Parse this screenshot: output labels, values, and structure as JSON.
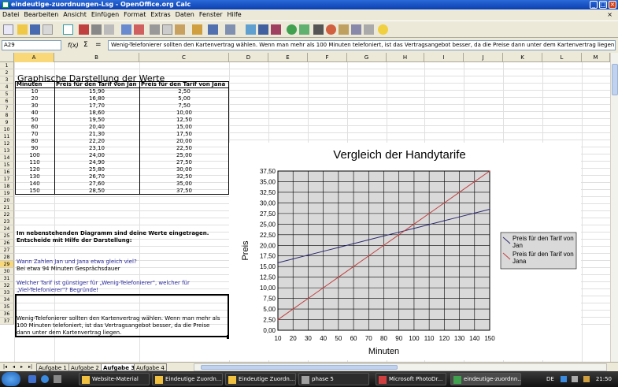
{
  "window": {
    "title": "eindeutige-zuordnungen-Lsg - OpenOffice.org Calc"
  },
  "menu": [
    "Datei",
    "Bearbeiten",
    "Ansicht",
    "Einfügen",
    "Format",
    "Extras",
    "Daten",
    "Fenster",
    "Hilfe"
  ],
  "formula": {
    "namebox": "A29",
    "fx": "f(x)",
    "sigma": "Σ",
    "eq": "=",
    "content": "Wenig-Telefonierer sollten den Kartenvertrag wählen. Wenn man mehr als 100 Minuten telefoniert, ist das Vertragsangebot besser, da die Preise dann unter dem Kartenvertrag liegen."
  },
  "columns": [
    "A",
    "B",
    "C",
    "D",
    "E",
    "F",
    "G",
    "H",
    "I",
    "J",
    "K",
    "L",
    "M"
  ],
  "rows": [
    "1",
    "2",
    "3",
    "4",
    "5",
    "6",
    "7",
    "8",
    "9",
    "10",
    "11",
    "12",
    "13",
    "14",
    "15",
    "16",
    "17",
    "18",
    "19",
    "20",
    "21",
    "22",
    "23",
    "24",
    "25",
    "26",
    "27",
    "28",
    "29",
    "30",
    "31",
    "32",
    "33",
    "34",
    "35",
    "36",
    "37"
  ],
  "sheet": {
    "heading": "Graphische Darstellung der Werte",
    "table_headers": [
      "Minuten",
      "Preis für den Tarif von Jan",
      "Preis für den Tarif von Jana"
    ],
    "table_rows": [
      [
        "10",
        "15,90",
        "2,50"
      ],
      [
        "20",
        "16,80",
        "5,00"
      ],
      [
        "30",
        "17,70",
        "7,50"
      ],
      [
        "40",
        "18,60",
        "10,00"
      ],
      [
        "50",
        "19,50",
        "12,50"
      ],
      [
        "60",
        "20,40",
        "15,00"
      ],
      [
        "70",
        "21,30",
        "17,50"
      ],
      [
        "80",
        "22,20",
        "20,00"
      ],
      [
        "90",
        "23,10",
        "22,50"
      ],
      [
        "100",
        "24,00",
        "25,00"
      ],
      [
        "110",
        "24,90",
        "27,50"
      ],
      [
        "120",
        "25,80",
        "30,00"
      ],
      [
        "130",
        "26,70",
        "32,50"
      ],
      [
        "140",
        "27,60",
        "35,00"
      ],
      [
        "150",
        "28,50",
        "37,50"
      ]
    ],
    "text21": "Im nebenstehenden Diagramm sind deine Werte eingetragen.",
    "text22": "Entscheide mit Hilfe der Darstellung:",
    "q24": "Wann Zahlen Jan und Jana etwa gleich viel?",
    "a25": "Bei etwa 94 Minuten Gesprächsdauer",
    "q27": "Welcher Tarif ist günstiger für „Wenig-Telefonierer\", welcher für",
    "q28": "„Viel-Telefonierer\"? Begründe!",
    "a31": "Wenig-Telefonierer sollten den Kartenvertrag wählen. Wenn man mehr als",
    "a32": "100 Minuten telefoniert, ist das Vertragsangebot besser, da die Preise",
    "a33": "dann unter dem Kartenvertrag liegen."
  },
  "chart_data": {
    "type": "line",
    "title": "Vergleich der Handytarife",
    "xlabel": "Minuten",
    "ylabel": "Preis",
    "x": [
      10,
      20,
      30,
      40,
      50,
      60,
      70,
      80,
      90,
      100,
      110,
      120,
      130,
      140,
      150
    ],
    "xlim": [
      10,
      150
    ],
    "ylim": [
      0,
      37.5
    ],
    "yticks": [
      "0,00",
      "2,50",
      "5,00",
      "7,50",
      "10,00",
      "12,50",
      "15,00",
      "17,50",
      "20,00",
      "22,50",
      "25,00",
      "27,50",
      "30,00",
      "32,50",
      "35,00",
      "37,50"
    ],
    "xticks": [
      "10",
      "20",
      "30",
      "40",
      "50",
      "60",
      "70",
      "80",
      "90",
      "100",
      "110",
      "120",
      "130",
      "140",
      "150"
    ],
    "grid": true,
    "legend": "right",
    "series": [
      {
        "name": "Preis für den Tarif von Jan",
        "color": "#2b2b6e",
        "values": [
          15.9,
          16.8,
          17.7,
          18.6,
          19.5,
          20.4,
          21.3,
          22.2,
          23.1,
          24.0,
          24.9,
          25.8,
          26.7,
          27.6,
          28.5
        ]
      },
      {
        "name": "Preis für den Tarif von Jana",
        "color": "#c04040",
        "values": [
          2.5,
          5.0,
          7.5,
          10.0,
          12.5,
          15.0,
          17.5,
          20.0,
          22.5,
          25.0,
          27.5,
          30.0,
          32.5,
          35.0,
          37.5
        ]
      }
    ]
  },
  "tabs": [
    "Aufgabe 1",
    "Aufgabe 2",
    "Aufgabe 3",
    "Aufgabe 4"
  ],
  "active_tab": "Aufgabe 3",
  "taskbar": {
    "items": [
      "Website-Material",
      "Eindeutige Zuordn...",
      "Eindeutige Zuordn...",
      "phase 5",
      "Microsoft PhotoDr...",
      "eindeutige-zuordnn..."
    ],
    "lang": "DE",
    "clock": "21:50"
  },
  "colors": {
    "selection": "#f8d878",
    "titlebar": "#0b3fb0"
  }
}
